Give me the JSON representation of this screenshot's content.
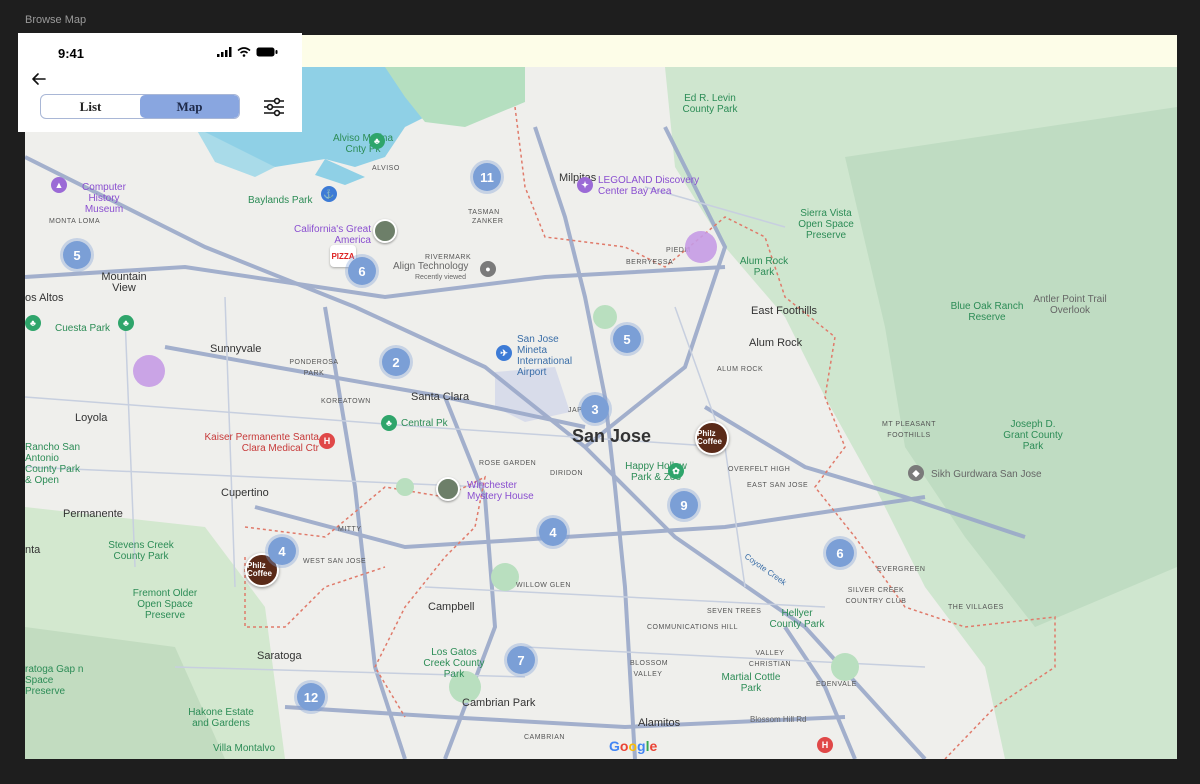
{
  "frame_title": "Browse Map",
  "status_bar": {
    "time": "9:41"
  },
  "view_toggle": {
    "list_label": "List",
    "map_label": "Map",
    "active": "Map"
  },
  "map": {
    "city_center": "San Jose",
    "clusters": [
      "11",
      "5",
      "6",
      "2",
      "5",
      "3",
      "9",
      "4",
      "4",
      "6",
      "7",
      "12"
    ],
    "labels": {
      "milpitas": "Milpitas",
      "mountain_view": "Mountain View",
      "sunnyvale": "Sunnyvale",
      "santa_clara": "Santa Clara",
      "cupertino": "Cupertino",
      "campbell": "Campbell",
      "saratoga": "Saratoga",
      "los_altos": "os Altos",
      "loyola": "Loyola",
      "permanente": "Permanente",
      "nta": "nta",
      "cambrian_park": "Cambrian Park",
      "alamitos": "Alamitos",
      "alum_rock": "Alum Rock",
      "east_foothills": "East Foothills",
      "monta_loma": "MONTA LOMA",
      "tasman": "TASMAN",
      "zanker": "ZANKER",
      "alviso": "ALVISO",
      "rivermark": "RIVERMARK",
      "berryessa": "BERRYESSA",
      "piedmont": "PIEDM",
      "ponderosa_park": "PONDEROSA PARK",
      "koreatown": "KOREATOWN",
      "japantown": "JAPANT",
      "rose_garden": "ROSE GARDEN",
      "diridon": "DIRIDON",
      "mitty": "MITTY",
      "west_san_jose": "WEST SAN JOSE",
      "willow_glen": "WILLOW GLEN",
      "cambrian": "CAMBRIAN",
      "overfelt_high": "OVERFELT HIGH",
      "east_san_jose": "EAST SAN JOSE",
      "alum_rock_hood": "ALUM ROCK",
      "mt_pleasant": "MT PLEASANT FOOTHILLS",
      "evergreen": "EVERGREEN",
      "silver_creek": "SILVER CREEK COUNTRY CLUB",
      "the_villages": "THE VILLAGES",
      "seven_trees": "SEVEN TREES",
      "communications_hill": "COMMUNICATIONS HILL",
      "blossom_valley": "BLOSSOM VALLEY",
      "valley_christian": "VALLEY CHRISTIAN",
      "edenvale": "EDENVALE",
      "blossom_hill_rd": "Blossom Hill Rd",
      "coyote_creek": "Coyote Creek",
      "computer_history": "Computer History Museum",
      "cuesta_park": "Cuesta Park",
      "baylands_park": "Baylands Park",
      "alviso_marina": "Alviso Marina Cnty Pk",
      "great_america": "California's Great America",
      "align_tech": "Align Technology",
      "recently_viewed": "Recently viewed",
      "legoland": "LEGOLAND Discovery Center Bay Area",
      "ed_levin": "Ed R. Levin County Park",
      "sierra_vista": "Sierra Vista Open Space Preserve",
      "alum_rock_park": "Alum Rock Park",
      "blue_oak": "Blue Oak Ranch Reserve",
      "antler_point": "Antler Point Trail Overlook",
      "joseph_grant": "Joseph D. Grant County Park",
      "sikh_gurdwara": "Sikh Gurdwara San Jose",
      "airport": "San Jose Mineta International Airport",
      "central_pk": "Central Pk",
      "kaiser": "Kaiser Permanente Santa Clara Medical Ctr",
      "rancho_san_antonio": "Rancho San Antonio County Park & Open",
      "winchester": "Winchester Mystery House",
      "happy_hollow": "Happy Hollow Park & Zoo",
      "stevens_creek": "Stevens Creek County Park",
      "fremont_older": "Fremont Older Open Space Preserve",
      "los_gatos_creek": "Los Gatos Creek County Park",
      "hellyer": "Hellyer County Park",
      "martial_cottle": "Martial Cottle Park",
      "hakone": "Hakone Estate and Gardens",
      "villa_montalvo": "Villa Montalvo",
      "sanborn": "ratoga Gap n Space Preserve",
      "pizza": "PIZZA",
      "philz": "Philz Coffee",
      "google": "Google"
    }
  }
}
